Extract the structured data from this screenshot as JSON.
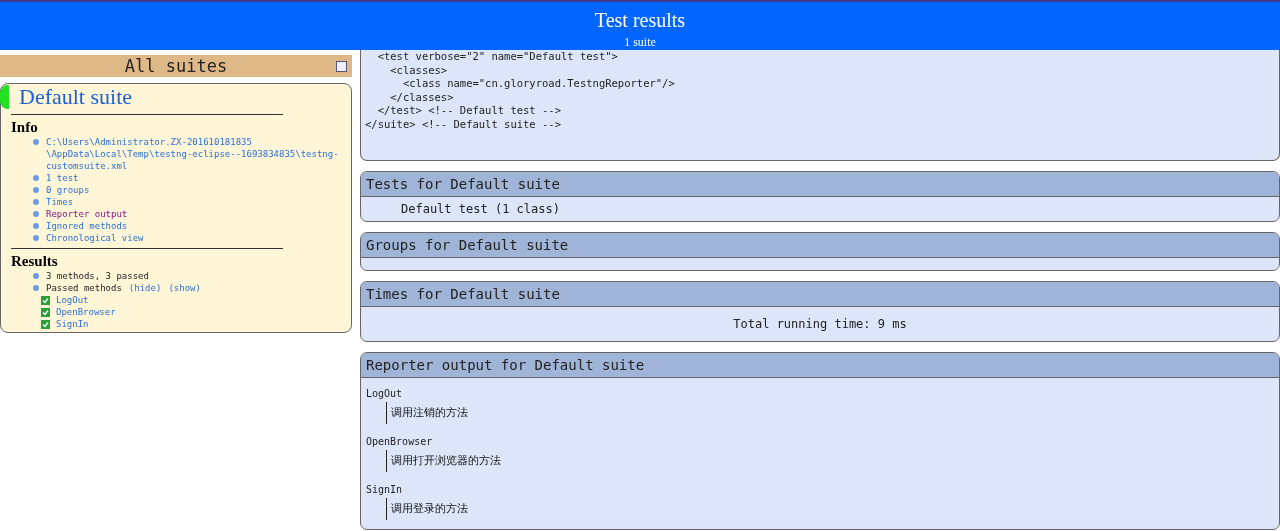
{
  "header": {
    "title": "Test results",
    "subtitle": "1 suite"
  },
  "sidebar": {
    "title": "All suites",
    "suite": {
      "name": "Default suite",
      "color": "#22e022"
    },
    "info": {
      "heading": "Info",
      "items": [
        {
          "text": "C:\\Users\\Administrator.ZX-201610181835\n\\AppData\\Local\\Temp\\testng-eclipse--1693834835\\testng-\ncustomsuite.xml",
          "visited": false
        },
        {
          "text": "1 test",
          "visited": false
        },
        {
          "text": "0 groups",
          "visited": false
        },
        {
          "text": "Times",
          "visited": false
        },
        {
          "text": "Reporter output",
          "visited": true
        },
        {
          "text": "Ignored methods",
          "visited": false
        },
        {
          "text": "Chronological view",
          "visited": false
        }
      ]
    },
    "results": {
      "heading": "Results",
      "summary": "3 methods, 3 passed",
      "passed_label": "Passed methods",
      "hide": "(hide)",
      "show": "(show)",
      "methods": [
        {
          "name": "LogOut",
          "checked": true
        },
        {
          "name": "OpenBrowser",
          "checked": true
        },
        {
          "name": "SignIn",
          "checked": true
        }
      ]
    }
  },
  "xml_lines": [
    "  <test verbose=\"2\" name=\"Default test\">",
    "    <classes>",
    "      <class name=\"cn.gloryroad.TestngReporter\"/>",
    "    </classes>",
    "  </test> <!-- Default test -->",
    "</suite> <!-- Default suite -->"
  ],
  "panels": [
    {
      "kind": "tests",
      "title": "Tests for Default suite",
      "text": "Default test (1 class)"
    },
    {
      "kind": "groups",
      "title": "Groups for Default suite"
    },
    {
      "kind": "times",
      "title": "Times for Default suite",
      "text": "Total running time: 9 ms"
    },
    {
      "kind": "reporter",
      "title": "Reporter output for Default suite",
      "entries": [
        {
          "method": "LogOut",
          "message": "调用注销的方法"
        },
        {
          "method": "OpenBrowser",
          "message": "调用打开浏览器的方法"
        },
        {
          "method": "SignIn",
          "message": "调用登录的方法"
        }
      ]
    }
  ]
}
